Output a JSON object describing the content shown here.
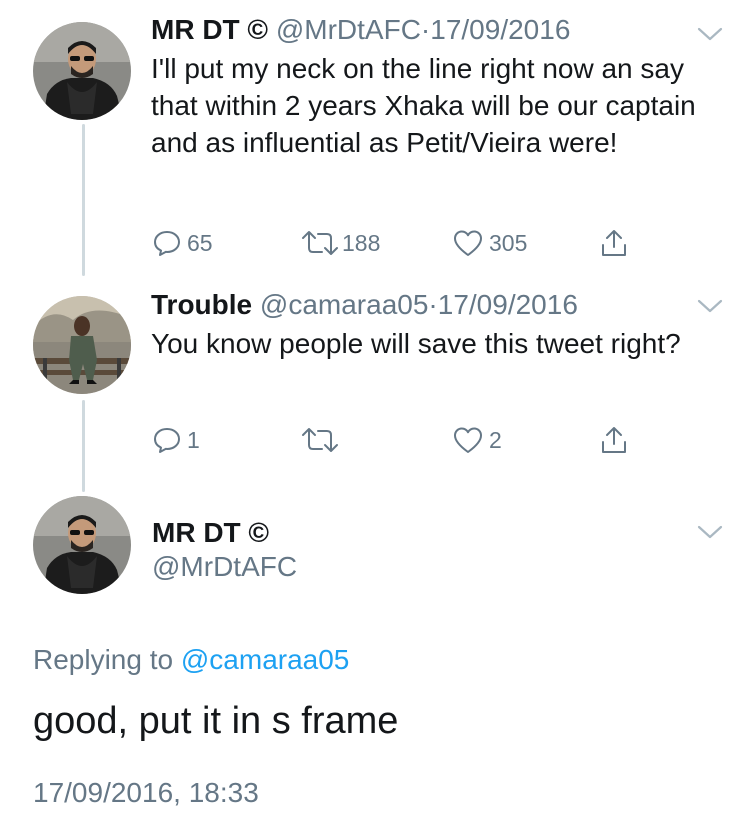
{
  "thread": {
    "tweets": [
      {
        "display_name": "MR DT ©",
        "handle": "@MrDtAFC",
        "separator": "·",
        "date": "17/09/2016",
        "text": "I'll put my neck on the line right now an say that within 2 years Xhaka will be our captain and as influential as Petit/Vieira were!",
        "avatar": "avatar-mrdt",
        "replies": "65",
        "retweets": "188",
        "likes": "305"
      },
      {
        "display_name": "Trouble",
        "handle": "@camaraa05",
        "separator": "·",
        "date": "17/09/2016",
        "text": "You know people will save this tweet right?",
        "avatar": "avatar-trouble",
        "replies": "1",
        "retweets": "",
        "likes": "2"
      }
    ]
  },
  "focused_tweet": {
    "display_name": "MR DT ©",
    "handle": "@MrDtAFC",
    "replying_prefix": "Replying to",
    "replying_to": "@camaraa05",
    "text": "good, put it in s frame",
    "timestamp": "17/09/2016, 18:33",
    "avatar": "avatar-mrdt"
  },
  "icons": {
    "reply": "reply-icon",
    "retweet": "retweet-icon",
    "like": "heart-icon",
    "share": "share-icon",
    "menu": "chevron-down-icon"
  },
  "colors": {
    "text": "#14171a",
    "secondary": "#657786",
    "link": "#1da1f2",
    "thread_line": "#cfd9de"
  }
}
